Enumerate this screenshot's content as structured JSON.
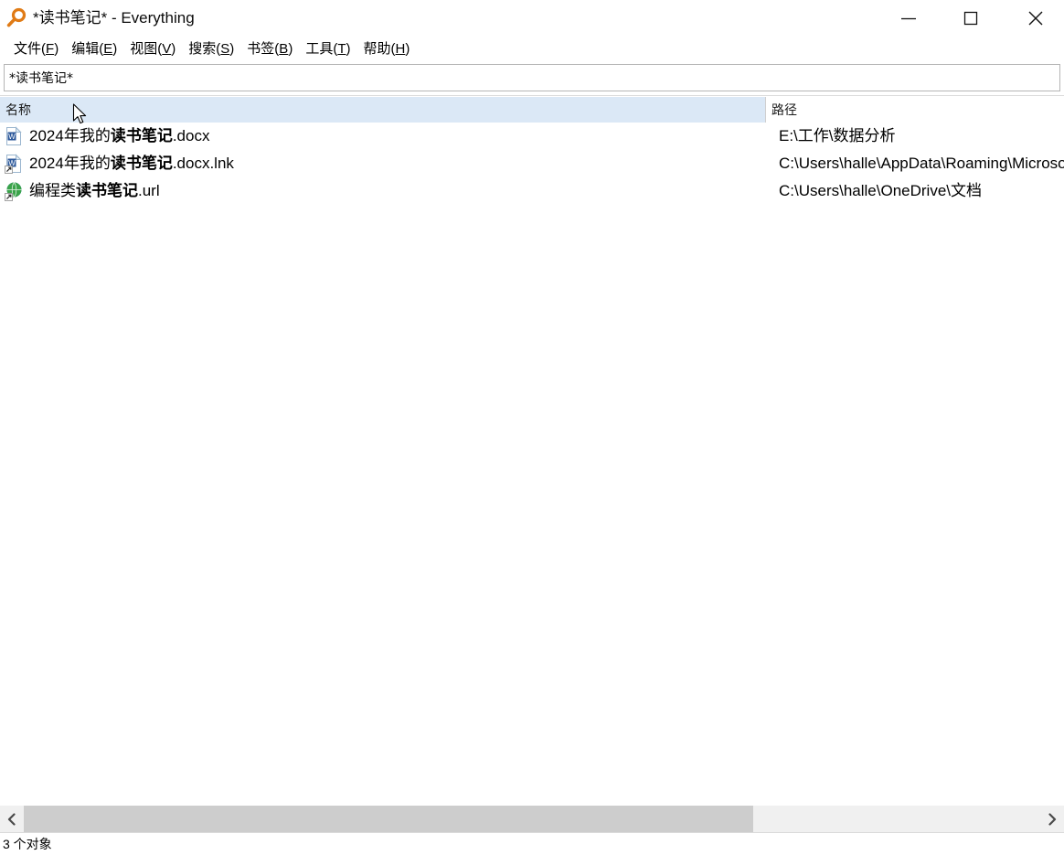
{
  "window": {
    "title": "*读书笔记* - Everything",
    "app_icon": "magnifier-icon",
    "accent": "#dd7a14",
    "controls": {
      "minimize": "minimize-icon",
      "maximize": "maximize-icon",
      "close": "close-icon"
    }
  },
  "menu": {
    "items": [
      {
        "label": "文件",
        "accel": "F"
      },
      {
        "label": "编辑",
        "accel": "E"
      },
      {
        "label": "视图",
        "accel": "V"
      },
      {
        "label": "搜索",
        "accel": "S"
      },
      {
        "label": "书签",
        "accel": "B"
      },
      {
        "label": "工具",
        "accel": "T"
      },
      {
        "label": "帮助",
        "accel": "H"
      }
    ]
  },
  "search": {
    "value": "*读书笔记*",
    "placeholder": ""
  },
  "columns": {
    "name": "名称",
    "path": "路径",
    "header_bg": "#dbe8f6"
  },
  "results": [
    {
      "icon": "word-document-icon",
      "name_prefix": "2024年我的",
      "name_match": "读书笔记",
      "name_suffix": ".docx",
      "path": "E:\\工作\\数据分析"
    },
    {
      "icon": "word-document-shortcut-icon",
      "name_prefix": "2024年我的",
      "name_match": "读书笔记",
      "name_suffix": ".docx.lnk",
      "path": "C:\\Users\\halle\\AppData\\Roaming\\Microsoft"
    },
    {
      "icon": "internet-shortcut-icon",
      "name_prefix": "编程类",
      "name_match": "读书笔记",
      "name_suffix": ".url",
      "path": "C:\\Users\\halle\\OneDrive\\文档"
    }
  ],
  "scrollbar": {
    "left_arrow": "chevron-left-icon",
    "right_arrow": "chevron-right-icon"
  },
  "status": {
    "text": "3 个对象"
  }
}
